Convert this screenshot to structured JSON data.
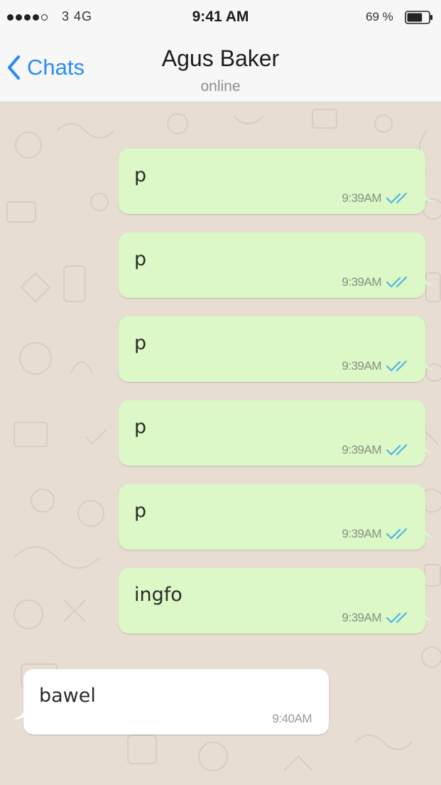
{
  "status_bar": {
    "carrier": "3  4G",
    "time": "9:41 AM",
    "battery_percent": "69 %",
    "signal_bars_filled": 4,
    "signal_bars_total": 5,
    "battery_level": 0.69
  },
  "nav": {
    "back_label": "Chats",
    "contact_name": "Agus Baker",
    "contact_status": "online",
    "accent_color": "#2a8cf5"
  },
  "colors": {
    "outgoing_bubble": "#dcf8c6",
    "incoming_bubble": "#ffffff",
    "chat_background": "#e7ddd3",
    "read_ticks": "#4fb5e6"
  },
  "messages": [
    {
      "direction": "outgoing",
      "text": "p",
      "time": "9:39AM",
      "status_icon": "double-check-icon"
    },
    {
      "direction": "outgoing",
      "text": "p",
      "time": "9:39AM",
      "status_icon": "double-check-icon"
    },
    {
      "direction": "outgoing",
      "text": "p",
      "time": "9:39AM",
      "status_icon": "double-check-icon"
    },
    {
      "direction": "outgoing",
      "text": "p",
      "time": "9:39AM",
      "status_icon": "double-check-icon"
    },
    {
      "direction": "outgoing",
      "text": "p",
      "time": "9:39AM",
      "status_icon": "double-check-icon"
    },
    {
      "direction": "outgoing",
      "text": "ingfo",
      "time": "9:39AM",
      "status_icon": "double-check-icon"
    },
    {
      "direction": "incoming",
      "text": "bawel",
      "time": "9:40AM"
    }
  ]
}
